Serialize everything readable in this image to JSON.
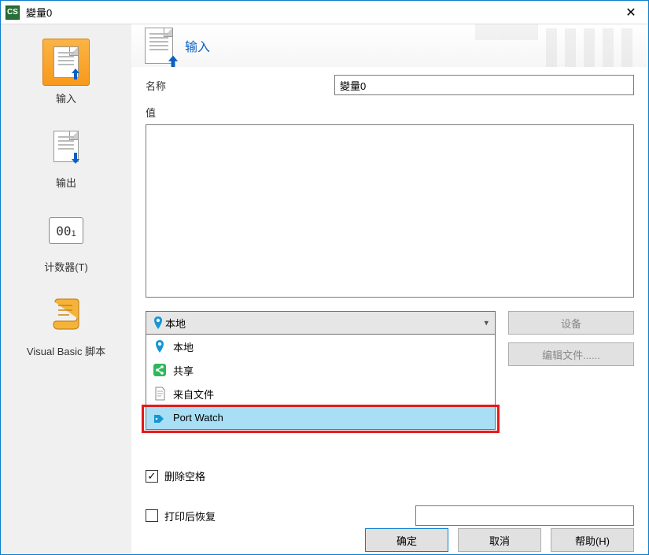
{
  "window": {
    "title": "變量0"
  },
  "sidebar": {
    "items": [
      {
        "label": "输入"
      },
      {
        "label": "输出"
      },
      {
        "label": "计数器(T)"
      },
      {
        "label": "Visual Basic 脚本"
      }
    ]
  },
  "header": {
    "heading": "输入"
  },
  "form": {
    "name_label": "名称",
    "name_value": "變量0",
    "value_label": "值",
    "value_text": ""
  },
  "dropdown": {
    "selected": "本地",
    "options": [
      {
        "label": "本地",
        "icon": "pin"
      },
      {
        "label": "共享",
        "icon": "share"
      },
      {
        "label": "来自文件",
        "icon": "file"
      },
      {
        "label": "Port Watch",
        "icon": "tag"
      }
    ]
  },
  "side_buttons": {
    "device": "设备",
    "edit_file": "编辑文件......"
  },
  "checkboxes": {
    "trim_spaces": "删除空格",
    "restore_after_print": "打印后恢复",
    "restore_value": ""
  },
  "footer": {
    "ok": "确定",
    "cancel": "取消",
    "help": "帮助(H)"
  }
}
